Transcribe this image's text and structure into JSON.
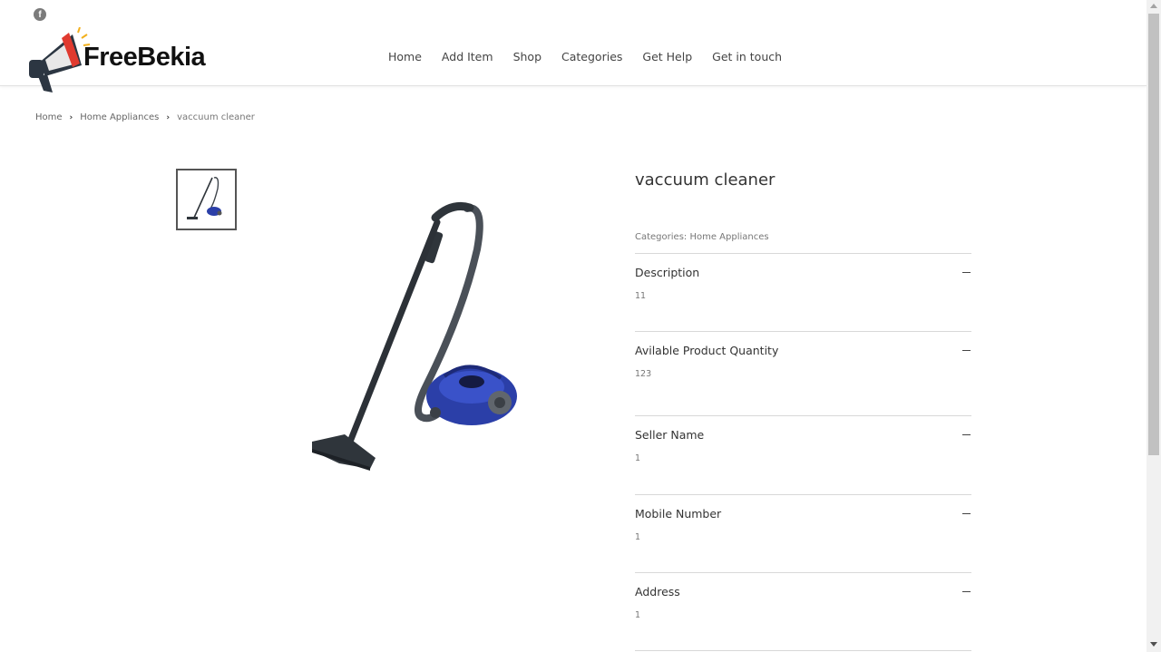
{
  "header": {
    "social_icon": "facebook-icon",
    "logo_text": "FreeBekia",
    "nav": [
      "Home",
      "Add Item",
      "Shop",
      "Categories",
      "Get Help",
      "Get in touch"
    ]
  },
  "breadcrumb": {
    "items": [
      "Home",
      "Home Appliances"
    ],
    "current": "vaccuum cleaner"
  },
  "product": {
    "title": "vaccuum cleaner",
    "categories_label": "Categories:",
    "category": "Home Appliances",
    "details": [
      {
        "title": "Description",
        "value": "11"
      },
      {
        "title": "Avilable Product Quantity",
        "value": "123"
      },
      {
        "title": "Seller Name",
        "value": "1"
      },
      {
        "title": "Mobile Number",
        "value": "1"
      },
      {
        "title": "Address",
        "value": "1"
      }
    ]
  },
  "colors": {
    "vacuum_body": "#2b3fa8",
    "logo_red": "#e03a2f"
  }
}
